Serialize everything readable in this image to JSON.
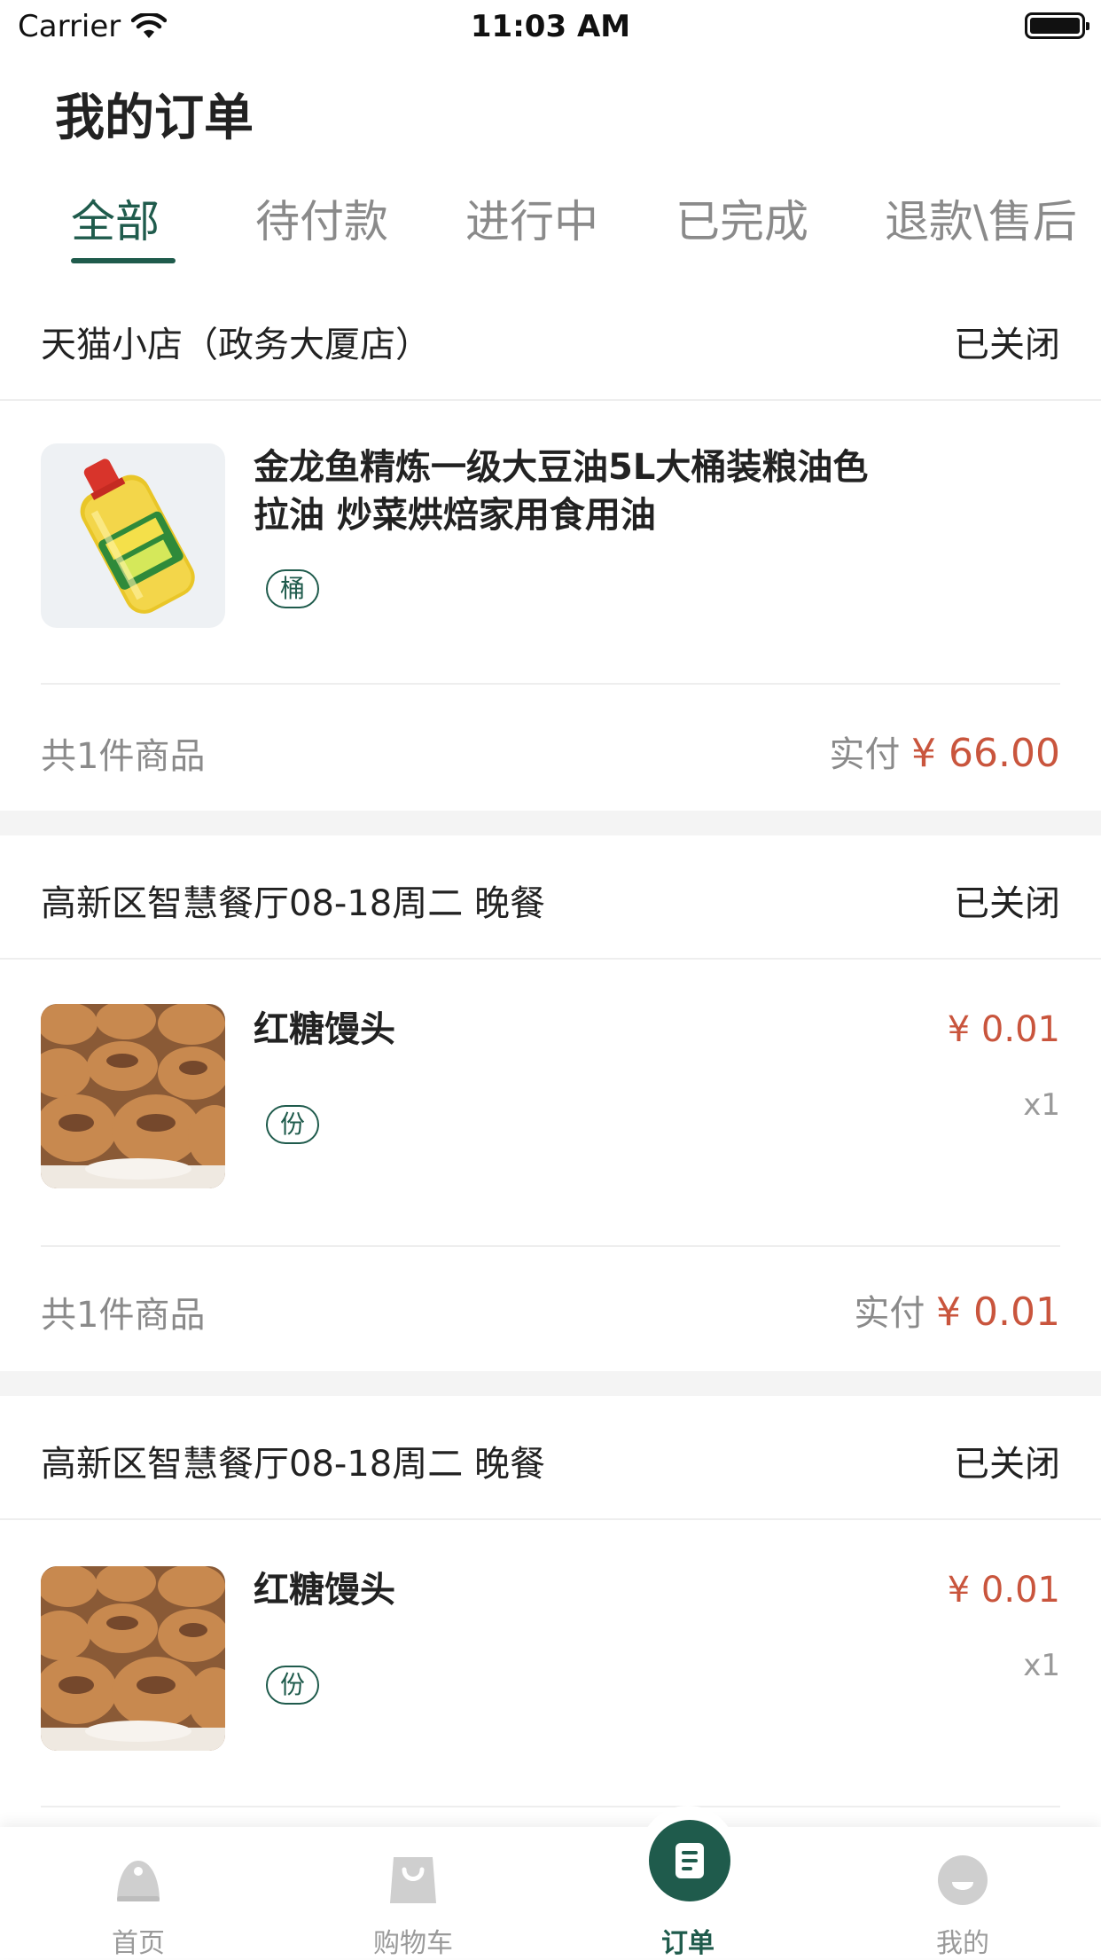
{
  "status_bar": {
    "carrier": "Carrier",
    "time": "11:03 AM"
  },
  "page_title": "我的订单",
  "tabs": [
    {
      "label": "全部",
      "active": true
    },
    {
      "label": "待付款",
      "active": false
    },
    {
      "label": "进行中",
      "active": false
    },
    {
      "label": "已完成",
      "active": false
    },
    {
      "label": "退款\\售后",
      "active": false
    }
  ],
  "orders": [
    {
      "store": "天猫小店（政务大厦店）",
      "status": "已关闭",
      "product": {
        "name": "金龙鱼精炼一级大豆油5L大桶装粮油色拉油 炒菜烘焙家用食用油",
        "spec": "桶",
        "image": "cooking-oil-bottle"
      },
      "count_text": "共1件商品",
      "paid_label": "实付",
      "paid_amount": "¥ 66.00"
    },
    {
      "store": "高新区智慧餐厅08-18周二 晚餐",
      "status": "已关闭",
      "product": {
        "name": "红糖馒头",
        "spec": "份",
        "price": "¥ 0.01",
        "qty": "x1",
        "image": "brown-sugar-buns"
      },
      "count_text": "共1件商品",
      "paid_label": "实付",
      "paid_amount": "¥ 0.01"
    },
    {
      "store": "高新区智慧餐厅08-18周二 晚餐",
      "status": "已关闭",
      "product": {
        "name": "红糖馒头",
        "spec": "份",
        "price": "¥ 0.01",
        "qty": "x1",
        "image": "brown-sugar-buns"
      }
    }
  ],
  "tab_bar": [
    {
      "label": "首页",
      "icon": "home-icon",
      "active": false
    },
    {
      "label": "购物车",
      "icon": "shopping-bag-icon",
      "active": false
    },
    {
      "label": "订单",
      "icon": "order-list-icon",
      "active": true
    },
    {
      "label": "我的",
      "icon": "profile-icon",
      "active": false
    }
  ],
  "colors": {
    "accent": "#1f5b4c",
    "price": "#c9553d",
    "muted": "#8a8a8a",
    "section_gap": "#f4f4f4"
  }
}
